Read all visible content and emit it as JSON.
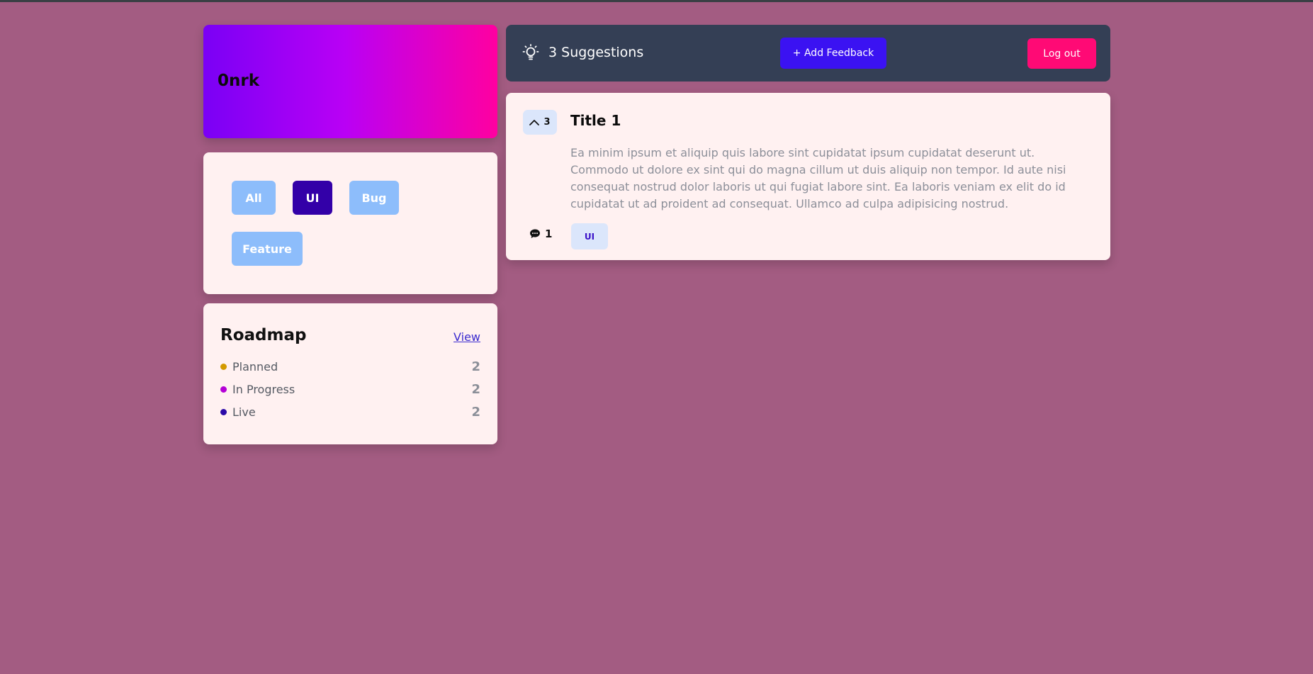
{
  "brand": {
    "title": "0nrk"
  },
  "filters": {
    "items": [
      {
        "label": "All",
        "active": false
      },
      {
        "label": "UI",
        "active": true
      },
      {
        "label": "Bug",
        "active": false
      },
      {
        "label": "Feature",
        "active": false
      }
    ]
  },
  "roadmap": {
    "title": "Roadmap",
    "view_label": "View",
    "items": [
      {
        "label": "Planned",
        "count": "2",
        "color": "#d39a00"
      },
      {
        "label": "In Progress",
        "count": "2",
        "color": "#b400d6"
      },
      {
        "label": "Live",
        "count": "2",
        "color": "#2b0aa8"
      }
    ]
  },
  "header": {
    "icon": "lightbulb-icon",
    "suggestions_label": "3 Suggestions",
    "add_feedback_label": "+ Add Feedback",
    "logout_label": "Log out"
  },
  "feedback": [
    {
      "upvotes": "3",
      "title": "Title 1",
      "body": "Ea minim ipsum et aliquip quis labore sint cupidatat ipsum cupidatat deserunt ut. Commodo ut dolore ex sint qui do magna cillum ut duis aliquip non tempor. Id aute nisi consequat nostrud dolor laboris ut qui fugiat labore sint. Ea laboris veniam ex elit do id cupidatat ut ad proident ad consequat. Ullamco ad culpa adipisicing nostrud.",
      "comments": "1",
      "tag": "UI"
    }
  ],
  "colors": {
    "page_bg": "#a35c82",
    "accent_blue": "#3b12f2",
    "accent_pink": "#ff0a75",
    "header_bg": "#343f55",
    "card_bg": "#fff1f1"
  }
}
